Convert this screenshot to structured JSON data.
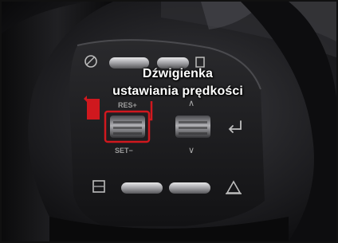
{
  "callout": {
    "line1": "Dźwigienka",
    "line2": "ustawiania prędkości"
  },
  "wheel_labels": {
    "res": "RES+",
    "set": "SET−",
    "down": "∨",
    "up": "∧"
  },
  "colors": {
    "highlight": "#d0181e",
    "panel": "#1b1b1d",
    "leather": "#121214",
    "label": "#b8b8b8"
  },
  "icons": [
    "driving-assist-icon",
    "cruise-toggle-icon",
    "lane-keep-icon",
    "mode-icon",
    "return-arrow-icon",
    "cancel-icon"
  ]
}
